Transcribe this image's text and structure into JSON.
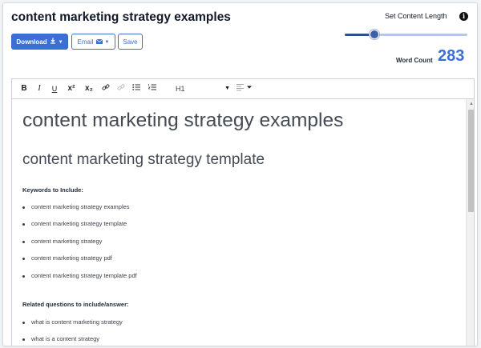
{
  "header": {
    "title": "content marketing strategy examples",
    "buttons": {
      "download_label": "Download",
      "email_label": "Email",
      "save_label": "Save"
    }
  },
  "content_length": {
    "label": "Set Content Length",
    "level": 0.24,
    "word_count_label": "Word Count",
    "word_count": "283"
  },
  "toolbar": {
    "bold": "B",
    "italic": "I",
    "underline": "U",
    "superscript": "x²",
    "subscript": "x₂",
    "heading_select": "H1"
  },
  "document": {
    "h1": "content marketing strategy examples",
    "h2": "content marketing strategy template",
    "keywords_heading": "Keywords to Include:",
    "keywords": [
      "content marketing strategy examples",
      "content marketing strategy template",
      "content marketing strategy",
      "content marketing strategy pdf",
      "content marketing strategy template pdf"
    ],
    "questions_heading": "Related questions to include/answer:",
    "questions": [
      "what is content marketing strategy",
      "what is a content strategy"
    ]
  },
  "colors": {
    "accent": "#3b6fd4",
    "slider_fill": "#2f4d8f"
  }
}
